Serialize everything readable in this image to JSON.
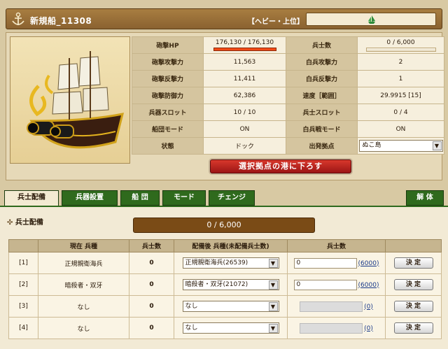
{
  "header": {
    "ship_name": "新規船_11308",
    "ship_class": "【ヘビー・上位】"
  },
  "stats": {
    "rows": [
      {
        "l1": "砲撃HP",
        "v1": "176,130 / 176,130",
        "l2": "兵士数",
        "v2": "0 / 6,000"
      },
      {
        "l1": "砲撃攻撃力",
        "v1": "11,563",
        "l2": "白兵攻撃力",
        "v2": "2"
      },
      {
        "l1": "砲撃反撃力",
        "v1": "11,411",
        "l2": "白兵反撃力",
        "v2": "1"
      },
      {
        "l1": "砲撃防御力",
        "v1": "62,386",
        "l2": "速度［範囲］",
        "v2": "29.9915 [15]"
      },
      {
        "l1": "兵器スロット",
        "v1": "10 / 10",
        "l2": "兵士スロット",
        "v2": "0 / 4"
      },
      {
        "l1": "船団モード",
        "v1": "ON",
        "l2": "白兵戦モード",
        "v2": "ON"
      },
      {
        "l1": "状態",
        "v1": "ドック",
        "l2": "出発拠点",
        "v2": "ぬこ島"
      }
    ],
    "hp_fraction": 1.0,
    "soldier_fraction": 0.0
  },
  "port_button": "選択拠点の港に下ろす",
  "tabs": [
    {
      "label": "兵士配備"
    },
    {
      "label": "兵器設置"
    },
    {
      "label": "船 団"
    },
    {
      "label": "モード"
    },
    {
      "label": "チェンジ"
    },
    {
      "label": "解 体"
    }
  ],
  "section_title": "兵士配備",
  "total_soldiers": "0 / 6,000",
  "deploy": {
    "headers": [
      "",
      "現在 兵種",
      "兵士数",
      "配備後 兵種(未配備兵士数)",
      "兵士数",
      ""
    ],
    "rows": [
      {
        "idx": "[1]",
        "current": "正規親衛海兵",
        "count": "0",
        "select": "正規親衛海兵(26539)",
        "input": "0",
        "max": "(6000)",
        "button": "決 定"
      },
      {
        "idx": "[2]",
        "current": "暗殺者・双牙",
        "count": "0",
        "select": "暗殺者・双牙(21072)",
        "input": "0",
        "max": "(6000)",
        "button": "決 定"
      },
      {
        "idx": "[3]",
        "current": "なし",
        "count": "0",
        "select": "なし",
        "input": "",
        "max": "(0)",
        "button": "決 定"
      },
      {
        "idx": "[4]",
        "current": "なし",
        "count": "0",
        "select": "なし",
        "input": "",
        "max": "(0)",
        "button": "決 定"
      }
    ]
  },
  "colors": {
    "tab_green": "#2f6a1d",
    "hp_bar": "#f24a17",
    "button_red": "#c02020",
    "total_bar": "#7a4b16"
  }
}
